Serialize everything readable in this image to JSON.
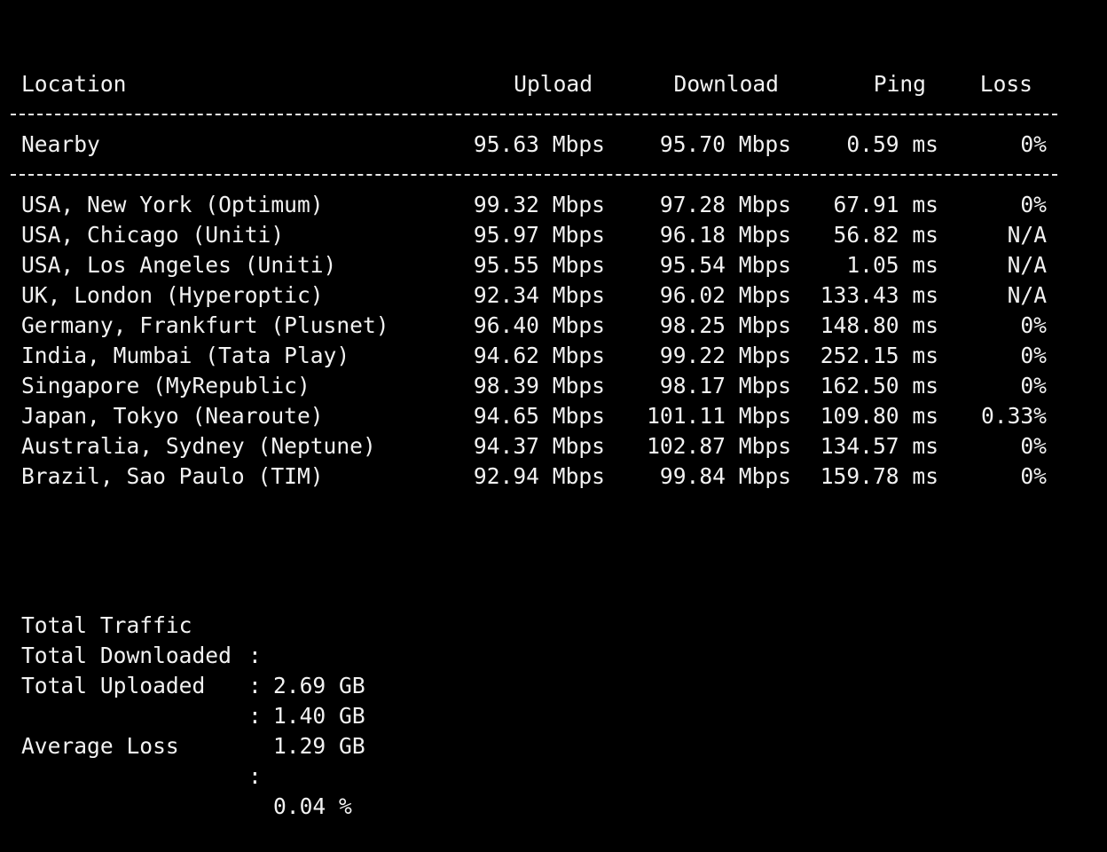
{
  "table": {
    "headers": {
      "location": "Location",
      "upload": "Upload",
      "download": "Download",
      "ping": "Ping",
      "loss": "Loss"
    },
    "nearby": {
      "location": "Nearby",
      "upload": "95.63 Mbps",
      "download": "95.70 Mbps",
      "ping": "0.59 ms",
      "loss": "0%"
    },
    "rows": [
      {
        "location": "USA, New York (Optimum)",
        "upload": "99.32 Mbps",
        "download": "97.28 Mbps",
        "ping": "67.91 ms",
        "loss": "0%"
      },
      {
        "location": "USA, Chicago (Uniti)",
        "upload": "95.97 Mbps",
        "download": "96.18 Mbps",
        "ping": "56.82 ms",
        "loss": "N/A"
      },
      {
        "location": "USA, Los Angeles (Uniti)",
        "upload": "95.55 Mbps",
        "download": "95.54 Mbps",
        "ping": "1.05 ms",
        "loss": "N/A"
      },
      {
        "location": "UK, London (Hyperoptic)",
        "upload": "92.34 Mbps",
        "download": "96.02 Mbps",
        "ping": "133.43 ms",
        "loss": "N/A"
      },
      {
        "location": "Germany, Frankfurt (Plusnet)",
        "upload": "96.40 Mbps",
        "download": "98.25 Mbps",
        "ping": "148.80 ms",
        "loss": "0%"
      },
      {
        "location": "India, Mumbai (Tata Play)",
        "upload": "94.62 Mbps",
        "download": "99.22 Mbps",
        "ping": "252.15 ms",
        "loss": "0%"
      },
      {
        "location": "Singapore (MyRepublic)",
        "upload": "98.39 Mbps",
        "download": "98.17 Mbps",
        "ping": "162.50 ms",
        "loss": "0%"
      },
      {
        "location": "Japan, Tokyo (Nearoute)",
        "upload": "94.65 Mbps",
        "download": "101.11 Mbps",
        "ping": "109.80 ms",
        "loss": "0.33%"
      },
      {
        "location": "Australia, Sydney (Neptune)",
        "upload": "94.37 Mbps",
        "download": "102.87 Mbps",
        "ping": "134.57 ms",
        "loss": "0%"
      },
      {
        "location": "Brazil, Sao Paulo (TIM)",
        "upload": "92.94 Mbps",
        "download": "99.84 Mbps",
        "ping": "159.78 ms",
        "loss": "0%"
      }
    ]
  },
  "summary": {
    "total_traffic_label": "Total Traffic",
    "total_traffic_value": "2.69 GB",
    "total_downloaded_label": "Total Downloaded",
    "total_downloaded_value": "1.40 GB",
    "total_uploaded_label": "Total Uploaded",
    "total_uploaded_value": "1.29 GB",
    "average_loss_label": "Average Loss",
    "average_loss_value": "0.04 %",
    "separator": ":"
  }
}
